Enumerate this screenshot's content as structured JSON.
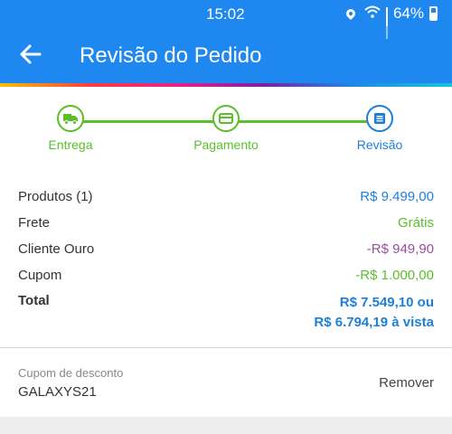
{
  "status_bar": {
    "time": "15:02",
    "battery": "64%",
    "icons": [
      "location-pin-icon",
      "wifi-icon",
      "signal-icon",
      "battery-icon"
    ]
  },
  "header": {
    "title": "Revisão do Pedido",
    "back_icon": "arrow-left-icon",
    "background_color": "#1e88f0"
  },
  "stepper": {
    "steps": [
      {
        "label": "Entrega",
        "icon": "truck-icon",
        "state": "done"
      },
      {
        "label": "Pagamento",
        "icon": "credit-card-icon",
        "state": "done"
      },
      {
        "label": "Revisão",
        "icon": "document-icon",
        "state": "active"
      }
    ],
    "colors": {
      "done": "#5bbf2a",
      "active": "#1e7fd8"
    }
  },
  "summary": {
    "rows": [
      {
        "label": "Produtos (1)",
        "value": "R$ 9.499,00",
        "color": "#1e7fd8"
      },
      {
        "label": "Frete",
        "value": "Grátis",
        "color": "#5bbf2a"
      },
      {
        "label": "Cliente Ouro",
        "value": "-R$ 949,90",
        "color": "#9b4ea3"
      },
      {
        "label": "Cupom",
        "value": "-R$ 1.000,00",
        "color": "#5bbf2a"
      }
    ],
    "total": {
      "label": "Total",
      "value_line1": "R$ 7.549,10 ou",
      "value_line2": "R$ 6.794,19 à vista"
    }
  },
  "coupon": {
    "caption": "Cupom de desconto",
    "code": "GALAXYS21",
    "remove_label": "Remover"
  }
}
